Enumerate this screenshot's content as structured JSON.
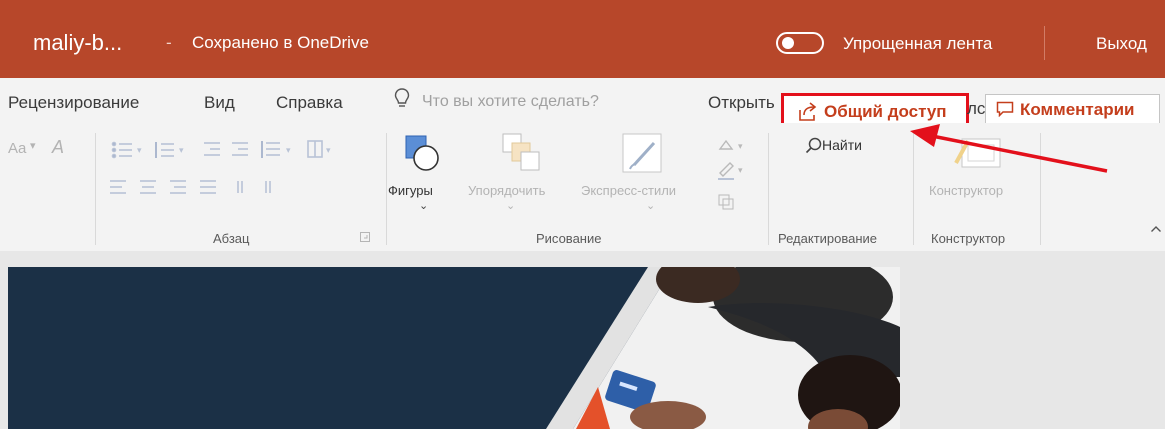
{
  "titlebar": {
    "document_name": "maliy-b...",
    "separator": "-",
    "save_status": "Сохранено в OneDrive",
    "simplified_ribbon_label": "Упрощенная лента",
    "exit_label": "Выход",
    "toggle_on": false,
    "background_color": "#b7472a"
  },
  "tabs": [
    {
      "label": "Рецензирование"
    },
    {
      "label": "Вид"
    },
    {
      "label": "Справка"
    }
  ],
  "tell_me": {
    "placeholder": "Что вы хотите сделать?",
    "icon": "lightbulb-icon"
  },
  "actions": {
    "open_label": "Открыть",
    "share_label": "Общий доступ",
    "share_icon": "share-icon",
    "partial_label": "лс",
    "comments_label": "Комментарии",
    "comments_icon": "comment-icon",
    "accent_color": "#c43e1c",
    "highlight_color": "#e3101b"
  },
  "ribbon": {
    "groups": {
      "paragraph": "Абзац",
      "drawing": "Рисование",
      "editing": "Редактирование",
      "designer": "Конструктор"
    },
    "font_controls": {
      "change_case": "Aa",
      "clear_format": "A"
    },
    "drawing": {
      "shapes": "Фигуры",
      "arrange": "Упорядочить",
      "quick_styles": "Экспресс-стили"
    },
    "editing": {
      "find": "Найти"
    },
    "designer": {
      "designer_button": "Конструктор"
    },
    "collapse_icon": "chevron-up-icon"
  },
  "annotation": {
    "arrow_color": "#e3101b"
  }
}
